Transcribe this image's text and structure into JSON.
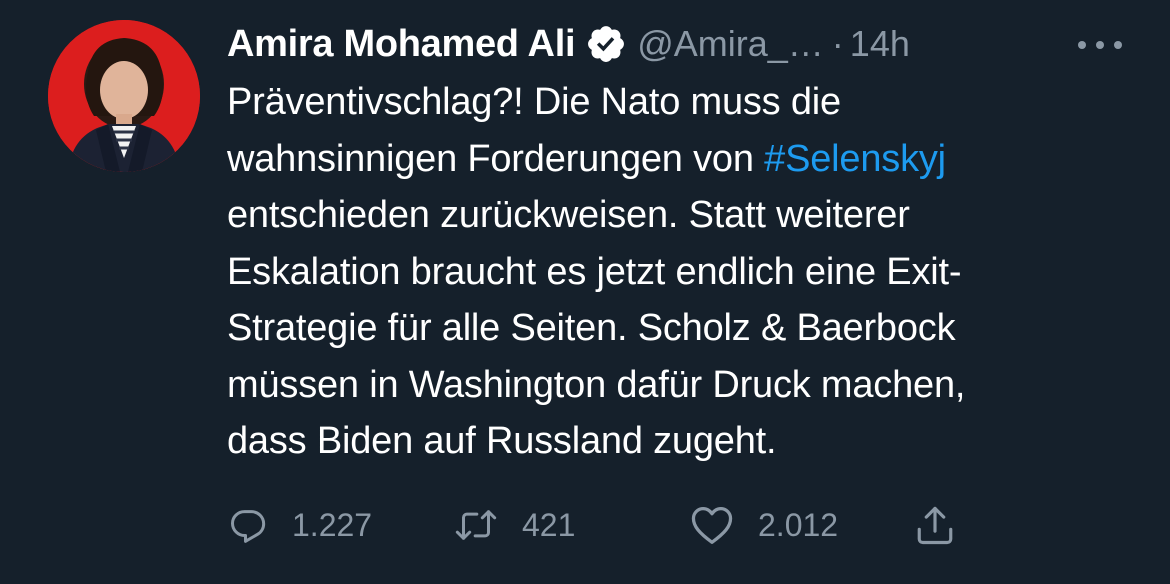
{
  "tweet": {
    "author": {
      "name": "Amira Mohamed Ali",
      "handle": "@Amira_…",
      "verified": true,
      "avatar": "profile-photo"
    },
    "separator": "·",
    "time": "14h",
    "more_icon": "more-horizontal-icon",
    "text_lines": [
      {
        "text": "Präventivschlag?! Die Nato muss die"
      },
      {
        "before": "wahnsinnigen Forderungen von ",
        "hashtag": "#Selenskyj"
      },
      {
        "text": "entschieden zurückweisen. Statt weiterer"
      },
      {
        "text": "Eskalation braucht es jetzt endlich eine Exit-"
      },
      {
        "text": "Strategie für alle Seiten. Scholz & Baerbock"
      },
      {
        "text": "müssen in Washington dafür Druck machen,"
      },
      {
        "text": "dass Biden auf Russland zugeht."
      }
    ],
    "actions": {
      "replies": "1.227",
      "retweets": "421",
      "likes": "2.012"
    }
  },
  "colors": {
    "background": "#15202b",
    "text": "#ffffff",
    "secondary": "#8b98a5",
    "link": "#1d9bf0",
    "avatar_bg": "#dc1e1e"
  }
}
